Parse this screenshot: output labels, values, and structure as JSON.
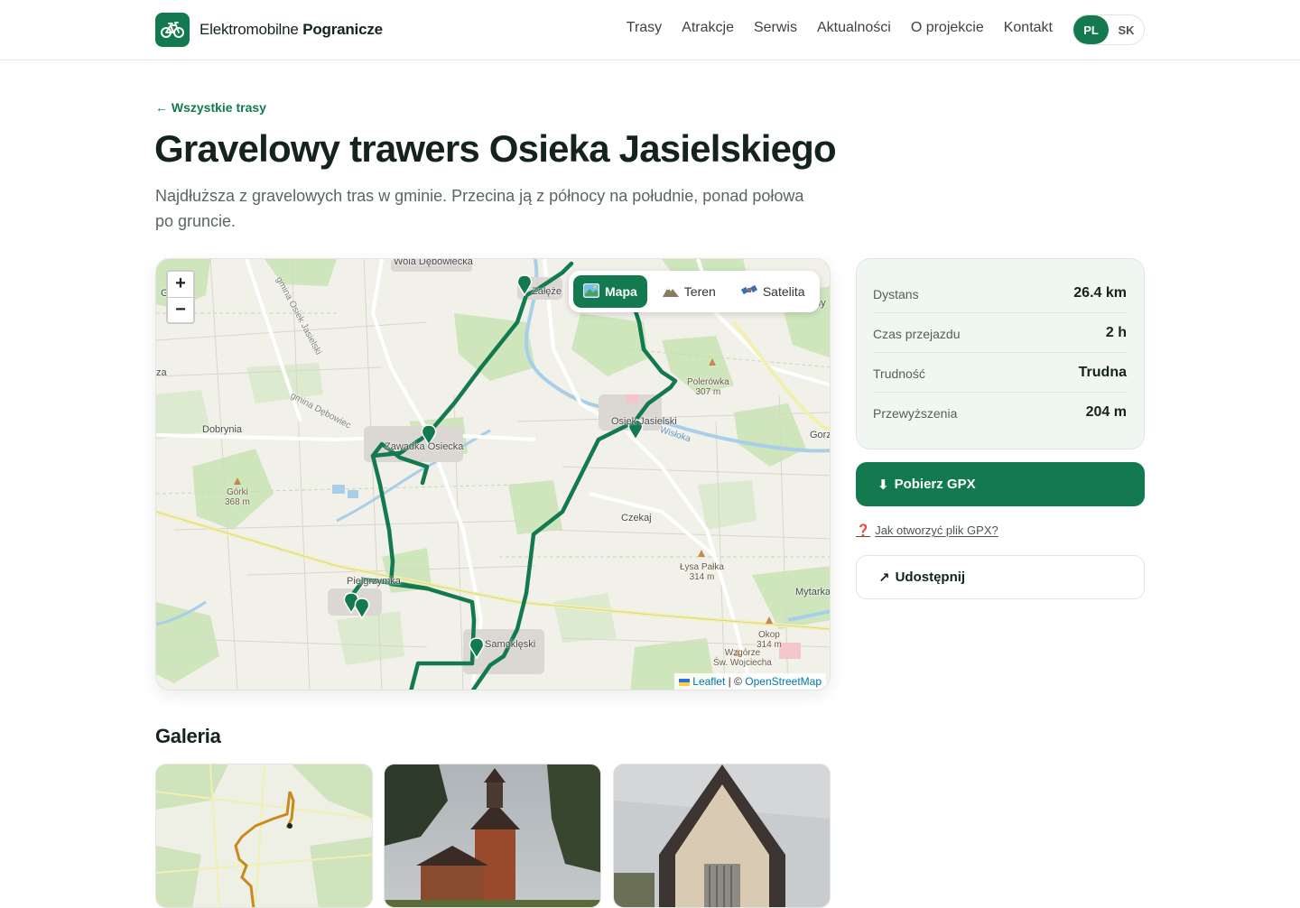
{
  "header": {
    "brand_part1": "Elektromobilne",
    "brand_part2": "Pogranicze",
    "nav": [
      "Trasy",
      "Atrakcje",
      "Serwis",
      "Aktualności",
      "O projekcie",
      "Kontakt"
    ],
    "languages": [
      "PL",
      "SK"
    ],
    "active_language": "PL",
    "accent_color": "#137a4f"
  },
  "page": {
    "back_link": "← Wszystkie trasy",
    "title": "Gravelowy trawers Osieka Jasielskiego",
    "lead": "Najdłuższa z gravelowych tras w gminie. Przecina ją z północy na południe, ponad połowa po gruncie."
  },
  "map": {
    "zoom_in": "+",
    "zoom_out": "−",
    "layers": [
      {
        "label": "Mapa",
        "icon": "map-icon",
        "active": true
      },
      {
        "label": "Teren",
        "icon": "mountain-icon",
        "active": false
      },
      {
        "label": "Satelita",
        "icon": "satellite-icon",
        "active": false
      }
    ],
    "places": {
      "wola": "Wola Dębowiecka",
      "zaleze": "Załęże",
      "gorka": "Górka",
      "gmina_osiek": "gmina Osiek Jasielski",
      "gmina_debowiec": "gmina Dębowiec",
      "dobrynia": "Dobrynia",
      "zawadka": "Zawadka Osiecka",
      "osiek": "Osiek Jasielski",
      "wisloka": "Wisłoka",
      "polerowka": "Polerówka",
      "polerowka_h": "307 m",
      "gorki": "Górki",
      "gorki_h": "368 m",
      "czekaj": "Czekaj",
      "lysa": "Łysa Pałka",
      "lysa_h": "314 m",
      "pielgrzymka": "Pielgrzymka",
      "mytarka": "Mytarka",
      "samoklęski": "Samoklęski",
      "okop": "Okop",
      "okop_h": "314 m",
      "wzgorze": "Wzgórze",
      "wzgorze2": "Św. Wojciecha",
      "gorz": "Gorz",
      "za": "za",
      "ny": "ny"
    },
    "attribution_leaflet": "Leaflet",
    "attribution_sep": "| ©",
    "attribution_osm": "OpenStreetMap",
    "route_color": "#137a4f"
  },
  "stats": [
    {
      "label": "Dystans",
      "value": "26.4 km"
    },
    {
      "label": "Czas przejazdu",
      "value": "2 h"
    },
    {
      "label": "Trudność",
      "value": "Trudna"
    },
    {
      "label": "Przewyższenia",
      "value": "204 m"
    }
  ],
  "actions": {
    "gpx_label": "Pobierz GPX",
    "gpx_help": "Jak otworzyć plik GPX?",
    "share_label": "Udostępnij"
  },
  "gallery": {
    "title": "Galeria"
  }
}
